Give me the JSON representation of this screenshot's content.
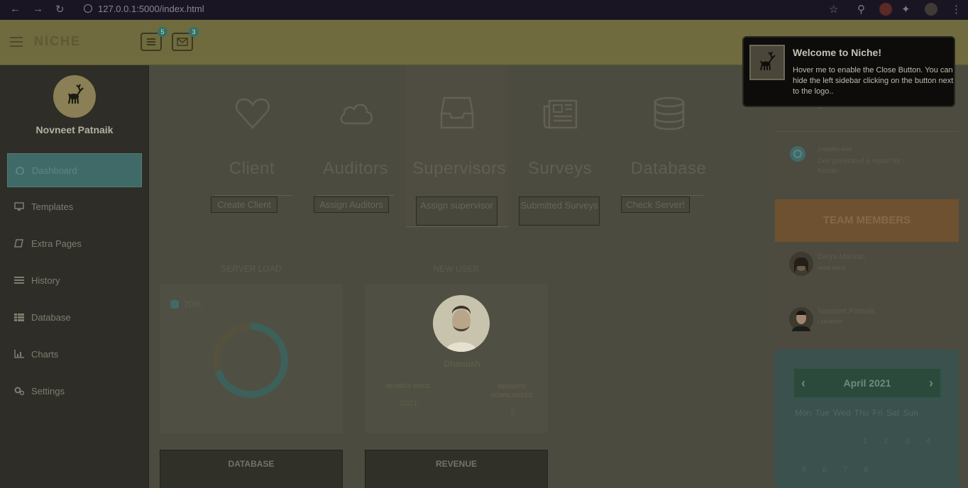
{
  "browser": {
    "url": "127.0.0.1:5000/index.html"
  },
  "header": {
    "brand": "NICHE",
    "task_badge": "5",
    "mail_badge": "3"
  },
  "sidebar": {
    "user_name": "Novneet Patnaik",
    "items": [
      {
        "label": "Dashboard",
        "icon": "dashboard-icon"
      },
      {
        "label": "Templates",
        "icon": "desktop-icon"
      },
      {
        "label": "Extra Pages",
        "icon": "book-icon"
      },
      {
        "label": "History",
        "icon": "list-icon"
      },
      {
        "label": "Database",
        "icon": "table-icon"
      },
      {
        "label": "Charts",
        "icon": "bar-chart-icon"
      },
      {
        "label": "Settings",
        "icon": "gears-icon"
      }
    ]
  },
  "tiles": [
    {
      "title": "Client",
      "button": "Create Client",
      "icon": "heart-icon"
    },
    {
      "title": "Auditors",
      "button": "Assign Auditors",
      "icon": "cloud-icon"
    },
    {
      "title": "Supervisors",
      "button": "Assign supervisor",
      "icon": "inbox-icon"
    },
    {
      "title": "Surveys",
      "button": "Submitted Surveys",
      "icon": "newspaper-icon"
    },
    {
      "title": "Database",
      "button": "Check Server!",
      "icon": "database-icon"
    }
  ],
  "server_load": {
    "title": "SERVER LOAD",
    "value": "70%",
    "fraction": 0.7
  },
  "new_user": {
    "title": "NEW USER",
    "name": "Dhanush",
    "member_since_label": "MEMBER SINCE",
    "member_since": "2021",
    "reports_label": "REPORTS DOWNLOADED",
    "reports": "2"
  },
  "bottom_panels": {
    "database": "DATABASE",
    "revenue": "REVENUE"
  },
  "activity": {
    "item1_count": "1",
    "item2_time": "3 HOURS AGO",
    "item2_text": "Dev generated a report for Nestle."
  },
  "team": {
    "title": "TEAM MEMBERS",
    "members": [
      {
        "name": "Divya Manian",
        "status": "AVAILABLE"
      },
      {
        "name": "Novneet Patnaik",
        "status": "I AM BUSY"
      }
    ]
  },
  "calendar": {
    "month": "April 2021",
    "days": [
      "Mon",
      "Tue",
      "Wed",
      "Thu",
      "Fri",
      "Sat",
      "Sun"
    ],
    "row1": [
      "1",
      "2",
      "3",
      "4"
    ],
    "row2": [
      "5",
      "6",
      "7",
      "8"
    ]
  },
  "notification": {
    "title": "Welcome to Niche!",
    "body": "Hover me to enable the Close Button. You can hide the left sidebar clicking on the button next to the logo.."
  },
  "colors": {
    "accent_teal": "#3f6a67",
    "team_header": "#6e5130"
  }
}
